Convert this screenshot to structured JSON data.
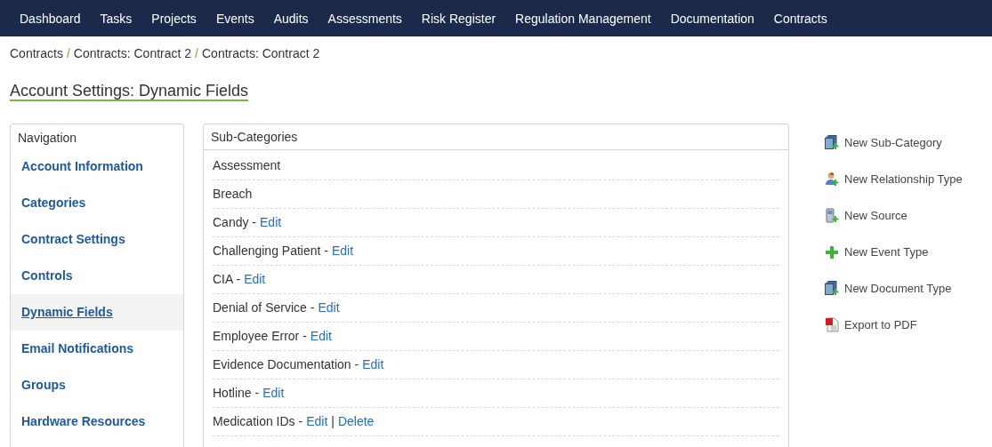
{
  "top_nav": [
    "Dashboard",
    "Tasks",
    "Projects",
    "Events",
    "Audits",
    "Assessments",
    "Risk Register",
    "Regulation Management",
    "Documentation",
    "Contracts"
  ],
  "breadcrumb": {
    "separator": "/",
    "items": [
      "Contracts",
      "Contracts: Contract 2",
      "Contracts: Contract 2"
    ]
  },
  "page_title": "Account Settings: Dynamic Fields",
  "sidebar": {
    "title": "Navigation",
    "items": [
      {
        "label": "Account Information",
        "selected": false
      },
      {
        "label": "Categories",
        "selected": false
      },
      {
        "label": "Contract Settings",
        "selected": false
      },
      {
        "label": "Controls",
        "selected": false
      },
      {
        "label": "Dynamic Fields",
        "selected": true
      },
      {
        "label": "Email Notifications",
        "selected": false
      },
      {
        "label": "Groups",
        "selected": false
      },
      {
        "label": "Hardware Resources",
        "selected": false
      }
    ]
  },
  "sub_categories": {
    "title": "Sub-Categories",
    "link_separator": "|",
    "rows": [
      {
        "name": "Assessment",
        "links": []
      },
      {
        "name": "Breach",
        "links": []
      },
      {
        "name": "Candy -",
        "links": [
          "Edit"
        ]
      },
      {
        "name": "Challenging Patient -",
        "links": [
          "Edit"
        ]
      },
      {
        "name": "CIA -",
        "links": [
          "Edit"
        ]
      },
      {
        "name": "Denial of Service -",
        "links": [
          "Edit"
        ]
      },
      {
        "name": "Employee Error -",
        "links": [
          "Edit"
        ]
      },
      {
        "name": "Evidence Documentation -",
        "links": [
          "Edit"
        ]
      },
      {
        "name": "Hotline -",
        "links": [
          "Edit"
        ]
      },
      {
        "name": "Medication IDs -",
        "links": [
          "Edit",
          "Delete"
        ]
      }
    ]
  },
  "actions": [
    {
      "label": "New Sub-Category",
      "kind": "stack"
    },
    {
      "label": "New Relationship Type",
      "kind": "person"
    },
    {
      "label": "New Source",
      "kind": "phone"
    },
    {
      "label": "New Event Type",
      "kind": "plus"
    },
    {
      "label": "New Document Type",
      "kind": "stack"
    },
    {
      "label": "Export to PDF",
      "kind": "pdf"
    }
  ]
}
